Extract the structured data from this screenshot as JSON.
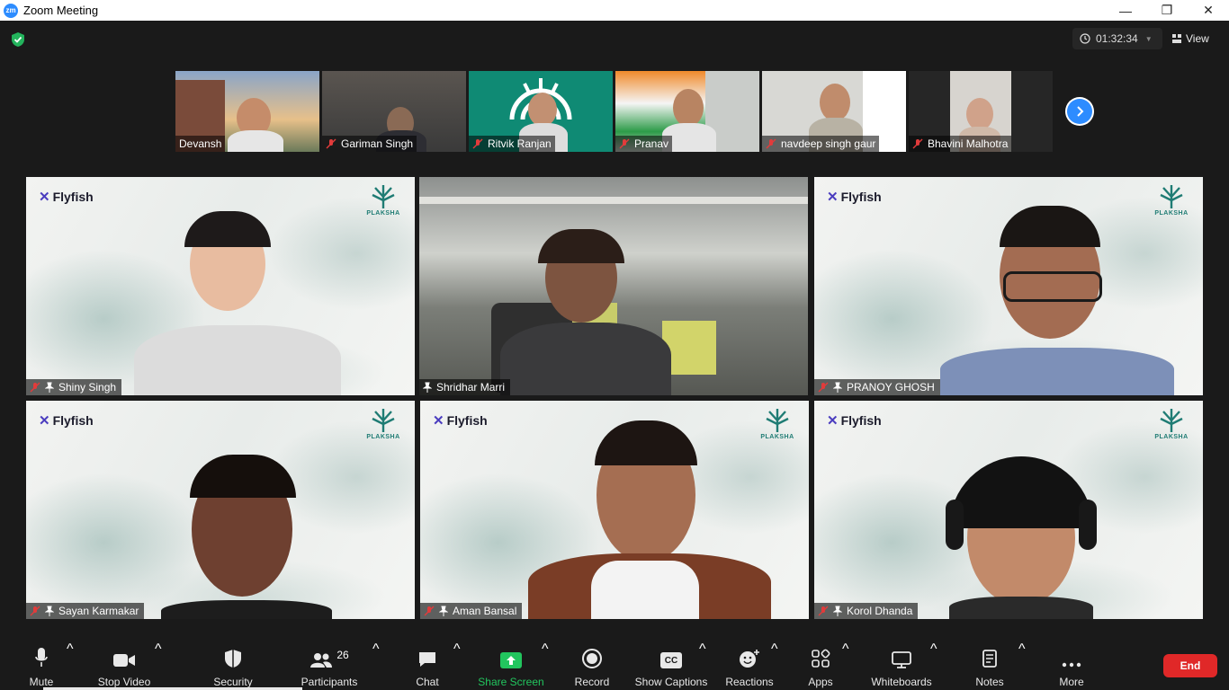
{
  "window": {
    "title": "Zoom Meeting",
    "minimize": "—",
    "maximize": "❐",
    "close": "✕"
  },
  "topbar": {
    "timer": "01:32:34",
    "view_label": "View"
  },
  "strip": {
    "participants": [
      {
        "name": "Devansh",
        "muted": false
      },
      {
        "name": "Gariman Singh",
        "muted": true
      },
      {
        "name": "Ritvik Ranjan",
        "muted": true
      },
      {
        "name": "Pranav",
        "muted": true
      },
      {
        "name": "navdeep singh gaur",
        "muted": true
      },
      {
        "name": "Bhavini Malhotra",
        "muted": true
      }
    ]
  },
  "grid": {
    "brand_left": "Flyfish",
    "brand_right": "PLAKSHA",
    "tiles": [
      {
        "name": "Shiny Singh",
        "muted": true,
        "active": false
      },
      {
        "name": "Shridhar Marri",
        "muted": false,
        "active": true
      },
      {
        "name": "PRANOY GHOSH",
        "muted": true,
        "active": false
      },
      {
        "name": "Sayan Karmakar",
        "muted": true,
        "active": false
      },
      {
        "name": "Aman Bansal",
        "muted": true,
        "active": false
      },
      {
        "name": "Korol Dhanda",
        "muted": true,
        "active": false
      }
    ]
  },
  "toolbar": {
    "mute": "Mute",
    "stop_video": "Stop Video",
    "security": "Security",
    "participants": "Participants",
    "participants_count": "26",
    "chat": "Chat",
    "share_screen": "Share Screen",
    "record": "Record",
    "show_captions": "Show Captions",
    "captions_icon_text": "CC",
    "reactions": "Reactions",
    "apps": "Apps",
    "whiteboards": "Whiteboards",
    "notes": "Notes",
    "more": "More",
    "end": "End"
  },
  "colors": {
    "accent": "#2d8cff",
    "share_green": "#22c55e",
    "end_red": "#e02828",
    "active_border": "#c6e06b"
  }
}
